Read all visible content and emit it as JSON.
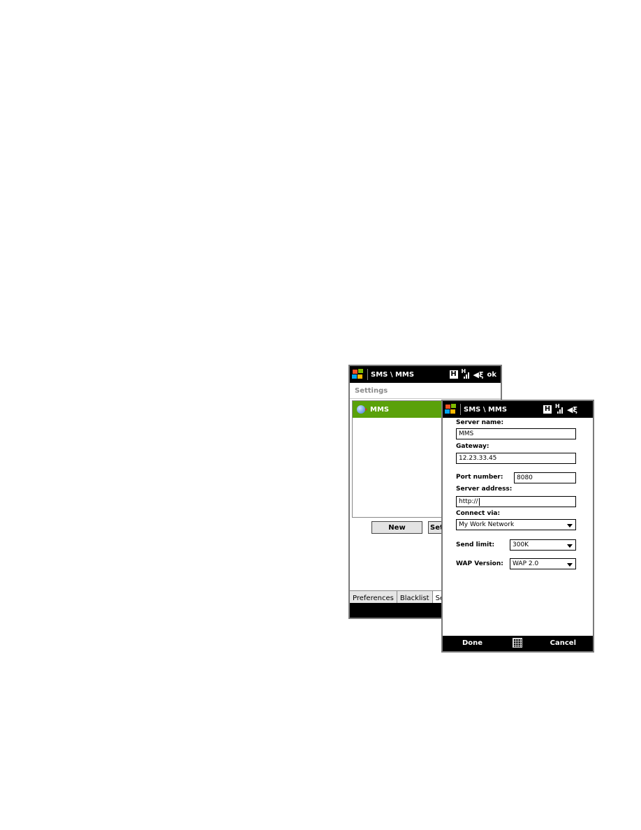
{
  "back_screen": {
    "title": "SMS \\ MMS",
    "status": {
      "network_badge": "H",
      "signal_label": "H",
      "ok_label": "ok"
    },
    "header": "Settings",
    "list": [
      {
        "label": "MMS",
        "icon": "globe-arrow-icon",
        "selected": true
      }
    ],
    "buttons": {
      "new_label": "New",
      "set_label": "Set"
    },
    "tabs": [
      {
        "label": "Preferences",
        "active": false
      },
      {
        "label": "Blacklist",
        "active": false
      },
      {
        "label": "Server",
        "active": true
      }
    ],
    "colors": {
      "selected_item": "#5aa10a",
      "title_bar": "#000000"
    }
  },
  "front_screen": {
    "title": "SMS \\ MMS",
    "status": {
      "network_badge": "H",
      "signal_label": "H"
    },
    "fields": {
      "server_name": {
        "label": "Server name:",
        "value": "MMS"
      },
      "gateway": {
        "label": "Gateway:",
        "value": "12.23.33.45"
      },
      "port_number": {
        "label": "Port number:",
        "value": "8080"
      },
      "server_address": {
        "label": "Server address:",
        "value": "http://"
      },
      "connect_via": {
        "label": "Connect via:",
        "value": "My Work Network"
      },
      "send_limit": {
        "label": "Send limit:",
        "value": "300K"
      },
      "wap_version": {
        "label": "WAP Version:",
        "value": "WAP 2.0"
      }
    },
    "softkeys": {
      "left": "Done",
      "right": "Cancel",
      "center_icon": "keyboard-icon"
    }
  }
}
